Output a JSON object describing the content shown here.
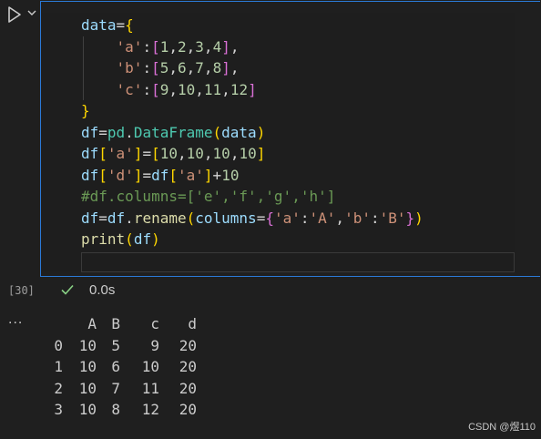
{
  "cell": {
    "code_lines": [
      [
        {
          "t": "data",
          "c": "c-var"
        },
        {
          "t": "=",
          "c": "c-op"
        },
        {
          "t": "{",
          "c": "c-brace"
        }
      ],
      [
        {
          "t": "    ",
          "c": "c-op"
        },
        {
          "t": "'a'",
          "c": "c-str"
        },
        {
          "t": ":",
          "c": "c-op"
        },
        {
          "t": "[",
          "c": "c-brk"
        },
        {
          "t": "1",
          "c": "c-num"
        },
        {
          "t": ",",
          "c": "c-op"
        },
        {
          "t": "2",
          "c": "c-num"
        },
        {
          "t": ",",
          "c": "c-op"
        },
        {
          "t": "3",
          "c": "c-num"
        },
        {
          "t": ",",
          "c": "c-op"
        },
        {
          "t": "4",
          "c": "c-num"
        },
        {
          "t": "]",
          "c": "c-brk"
        },
        {
          "t": ",",
          "c": "c-op"
        }
      ],
      [
        {
          "t": "    ",
          "c": "c-op"
        },
        {
          "t": "'b'",
          "c": "c-str"
        },
        {
          "t": ":",
          "c": "c-op"
        },
        {
          "t": "[",
          "c": "c-brk"
        },
        {
          "t": "5",
          "c": "c-num"
        },
        {
          "t": ",",
          "c": "c-op"
        },
        {
          "t": "6",
          "c": "c-num"
        },
        {
          "t": ",",
          "c": "c-op"
        },
        {
          "t": "7",
          "c": "c-num"
        },
        {
          "t": ",",
          "c": "c-op"
        },
        {
          "t": "8",
          "c": "c-num"
        },
        {
          "t": "]",
          "c": "c-brk"
        },
        {
          "t": ",",
          "c": "c-op"
        }
      ],
      [
        {
          "t": "    ",
          "c": "c-op"
        },
        {
          "t": "'c'",
          "c": "c-str"
        },
        {
          "t": ":",
          "c": "c-op"
        },
        {
          "t": "[",
          "c": "c-brk"
        },
        {
          "t": "9",
          "c": "c-num"
        },
        {
          "t": ",",
          "c": "c-op"
        },
        {
          "t": "10",
          "c": "c-num"
        },
        {
          "t": ",",
          "c": "c-op"
        },
        {
          "t": "11",
          "c": "c-num"
        },
        {
          "t": ",",
          "c": "c-op"
        },
        {
          "t": "12",
          "c": "c-num"
        },
        {
          "t": "]",
          "c": "c-brk"
        }
      ],
      [
        {
          "t": "}",
          "c": "c-brace"
        }
      ],
      [
        {
          "t": "df",
          "c": "c-var"
        },
        {
          "t": "=",
          "c": "c-op"
        },
        {
          "t": "pd",
          "c": "c-cls"
        },
        {
          "t": ".",
          "c": "c-op"
        },
        {
          "t": "DataFrame",
          "c": "c-cls"
        },
        {
          "t": "(",
          "c": "c-brace"
        },
        {
          "t": "data",
          "c": "c-var"
        },
        {
          "t": ")",
          "c": "c-brace"
        }
      ],
      [
        {
          "t": "df",
          "c": "c-var"
        },
        {
          "t": "[",
          "c": "c-brace"
        },
        {
          "t": "'a'",
          "c": "c-str"
        },
        {
          "t": "]",
          "c": "c-brace"
        },
        {
          "t": "=",
          "c": "c-op"
        },
        {
          "t": "[",
          "c": "c-brace"
        },
        {
          "t": "10",
          "c": "c-num"
        },
        {
          "t": ",",
          "c": "c-op"
        },
        {
          "t": "10",
          "c": "c-num"
        },
        {
          "t": ",",
          "c": "c-op"
        },
        {
          "t": "10",
          "c": "c-num"
        },
        {
          "t": ",",
          "c": "c-op"
        },
        {
          "t": "10",
          "c": "c-num"
        },
        {
          "t": "]",
          "c": "c-brace"
        }
      ],
      [
        {
          "t": "df",
          "c": "c-var"
        },
        {
          "t": "[",
          "c": "c-brace"
        },
        {
          "t": "'d'",
          "c": "c-str"
        },
        {
          "t": "]",
          "c": "c-brace"
        },
        {
          "t": "=",
          "c": "c-op"
        },
        {
          "t": "df",
          "c": "c-var"
        },
        {
          "t": "[",
          "c": "c-brace"
        },
        {
          "t": "'a'",
          "c": "c-str"
        },
        {
          "t": "]",
          "c": "c-brace"
        },
        {
          "t": "+",
          "c": "c-op"
        },
        {
          "t": "10",
          "c": "c-num"
        }
      ],
      [
        {
          "t": "#df.columns=['e','f','g','h']",
          "c": "c-cmt"
        }
      ],
      [
        {
          "t": "df",
          "c": "c-var"
        },
        {
          "t": "=",
          "c": "c-op"
        },
        {
          "t": "df",
          "c": "c-var"
        },
        {
          "t": ".",
          "c": "c-op"
        },
        {
          "t": "rename",
          "c": "c-fn"
        },
        {
          "t": "(",
          "c": "c-brace"
        },
        {
          "t": "columns",
          "c": "c-var"
        },
        {
          "t": "=",
          "c": "c-op"
        },
        {
          "t": "{",
          "c": "c-brk"
        },
        {
          "t": "'a'",
          "c": "c-str"
        },
        {
          "t": ":",
          "c": "c-op"
        },
        {
          "t": "'A'",
          "c": "c-str"
        },
        {
          "t": ",",
          "c": "c-op"
        },
        {
          "t": "'b'",
          "c": "c-str"
        },
        {
          "t": ":",
          "c": "c-op"
        },
        {
          "t": "'B'",
          "c": "c-str"
        },
        {
          "t": "}",
          "c": "c-brk"
        },
        {
          "t": ")",
          "c": "c-brace"
        }
      ],
      [
        {
          "t": "print",
          "c": "c-fn"
        },
        {
          "t": "(",
          "c": "c-brace"
        },
        {
          "t": "df",
          "c": "c-var"
        },
        {
          "t": ")",
          "c": "c-brace"
        }
      ]
    ],
    "execution_count": "[30]",
    "duration": "0.0s"
  },
  "output": {
    "menu_label": "...",
    "columns": [
      "",
      "A",
      "B",
      "c",
      "d"
    ],
    "rows": [
      [
        "0",
        "10",
        "5",
        "9",
        "20"
      ],
      [
        "1",
        "10",
        "6",
        "10",
        "20"
      ],
      [
        "2",
        "10",
        "7",
        "11",
        "20"
      ],
      [
        "3",
        "10",
        "8",
        "12",
        "20"
      ]
    ]
  },
  "watermark": "CSDN @煜110",
  "colors": {
    "background": "#1f1f1f",
    "cell_border": "#2b79d6",
    "success_check": "#89d185"
  },
  "icons": {
    "run": "play-icon",
    "run_options": "chevron-down-icon",
    "status": "check-icon",
    "output_menu": "ellipsis-icon"
  }
}
